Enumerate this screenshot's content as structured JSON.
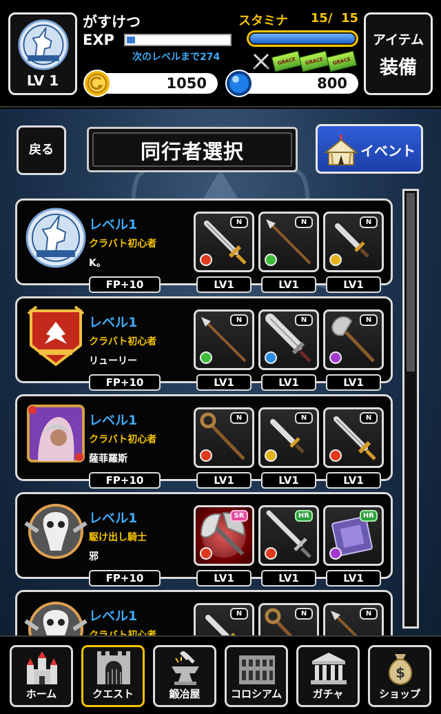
{
  "header": {
    "player_name": "がすけつ",
    "level_label": "LV 1",
    "exp_label": "EXP",
    "exp_next": "次のレベルまで274",
    "exp_fill": 0.08,
    "stamina_label": "スタミナ",
    "stamina_value": "15/  15",
    "stamina_fill": 1.0,
    "gold": "1050",
    "gems": "800",
    "item_line1": "アイテム",
    "item_line2": "装備",
    "ticket_text": "GRACE"
  },
  "page": {
    "back_label": "戻る",
    "title": "同行者選択",
    "event_label": "イベント",
    "scroll_fraction": 0.41
  },
  "companions": [
    {
      "level": "レベル1",
      "title": "クラバト初心者",
      "name": "K。",
      "fp": "FP+10",
      "emblem": "unicorn",
      "weapons": [
        {
          "rarity": "N",
          "type": "sword-gold",
          "element": "fire",
          "lv": "LV1"
        },
        {
          "rarity": "N",
          "type": "spear",
          "element": "wind",
          "lv": "LV1"
        },
        {
          "rarity": "N",
          "type": "dagger",
          "element": "light",
          "lv": "LV1"
        }
      ]
    },
    {
      "level": "レベル1",
      "title": "クラバト初心者",
      "name": "リューリー",
      "fp": "FP+10",
      "emblem": "phoenix",
      "weapons": [
        {
          "rarity": "N",
          "type": "spear",
          "element": "wind",
          "lv": "LV1"
        },
        {
          "rarity": "N",
          "type": "broadsword",
          "element": "water",
          "lv": "LV1"
        },
        {
          "rarity": "N",
          "type": "axe",
          "element": "dark",
          "lv": "LV1"
        }
      ]
    },
    {
      "level": "レベル1",
      "title": "クラバト初心者",
      "name": "薩菲羅斯",
      "fp": "FP+10",
      "emblem": "sorceress",
      "weapons": [
        {
          "rarity": "N",
          "type": "staff",
          "element": "fire",
          "lv": "LV1"
        },
        {
          "rarity": "N",
          "type": "dagger",
          "element": "light",
          "lv": "LV1"
        },
        {
          "rarity": "N",
          "type": "sword-gold",
          "element": "fire",
          "lv": "LV1"
        }
      ]
    },
    {
      "level": "レベル1",
      "title": "駆け出し騎士",
      "name": "邪",
      "fp": "FP+10",
      "emblem": "skull",
      "weapons": [
        {
          "rarity": "SR",
          "type": "battleaxe",
          "element": "fire",
          "lv": "LV1"
        },
        {
          "rarity": "HR",
          "type": "longsword",
          "element": "fire",
          "lv": "LV1"
        },
        {
          "rarity": "HR",
          "type": "tome",
          "element": "dark",
          "lv": "LV1"
        }
      ]
    },
    {
      "level": "レベル1",
      "title": "クラバト初心者",
      "name": "",
      "fp": "",
      "emblem": "skull",
      "weapons": [
        {
          "rarity": "N",
          "type": "dagger",
          "element": "fire",
          "lv": ""
        },
        {
          "rarity": "N",
          "type": "staff",
          "element": "fire",
          "lv": ""
        },
        {
          "rarity": "N",
          "type": "spear",
          "element": "fire",
          "lv": ""
        }
      ]
    }
  ],
  "nav": [
    {
      "label": "ホーム",
      "icon": "castle-icon",
      "active": false
    },
    {
      "label": "クエスト",
      "icon": "gate-icon",
      "active": true
    },
    {
      "label": "鍛冶屋",
      "icon": "anvil-icon",
      "active": false
    },
    {
      "label": "コロシアム",
      "icon": "colosseum-icon",
      "active": false
    },
    {
      "label": "ガチャ",
      "icon": "temple-icon",
      "active": false
    },
    {
      "label": "ショップ",
      "icon": "money-bag-icon",
      "active": false
    }
  ],
  "colors": {
    "accent_yellow": "#f5c400",
    "accent_blue": "#3fa9f5",
    "event_blue": "#2f5fd6"
  }
}
